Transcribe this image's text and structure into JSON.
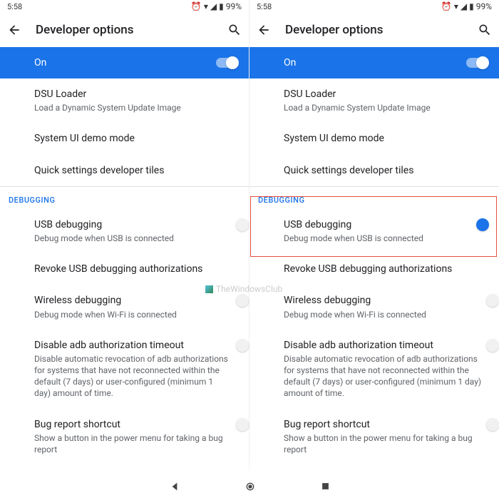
{
  "status": {
    "time": "5:58",
    "battery": "99%"
  },
  "appbar": {
    "title": "Developer options"
  },
  "master": {
    "label": "On"
  },
  "sections": {
    "debugging": "DEBUGGING"
  },
  "items": {
    "dsu": {
      "title": "DSU Loader",
      "sub": "Load a Dynamic System Update Image"
    },
    "demo": {
      "title": "System UI demo mode"
    },
    "tiles": {
      "title": "Quick settings developer tiles"
    },
    "usb": {
      "title": "USB debugging",
      "sub": "Debug mode when USB is connected"
    },
    "revoke": {
      "title": "Revoke USB debugging authorizations"
    },
    "wireless": {
      "title": "Wireless debugging",
      "sub": "Debug mode when Wi-Fi is connected"
    },
    "adb": {
      "title": "Disable adb authorization timeout",
      "sub": "Disable automatic revocation of adb authorizations for systems that have not reconnected within the default (7 days) or user-configured (minimum 1 day) amount of time."
    },
    "bug": {
      "title": "Bug report shortcut",
      "sub": "Show a button in the power menu for taking a bug report"
    }
  },
  "watermark": "TheWindowsClub"
}
